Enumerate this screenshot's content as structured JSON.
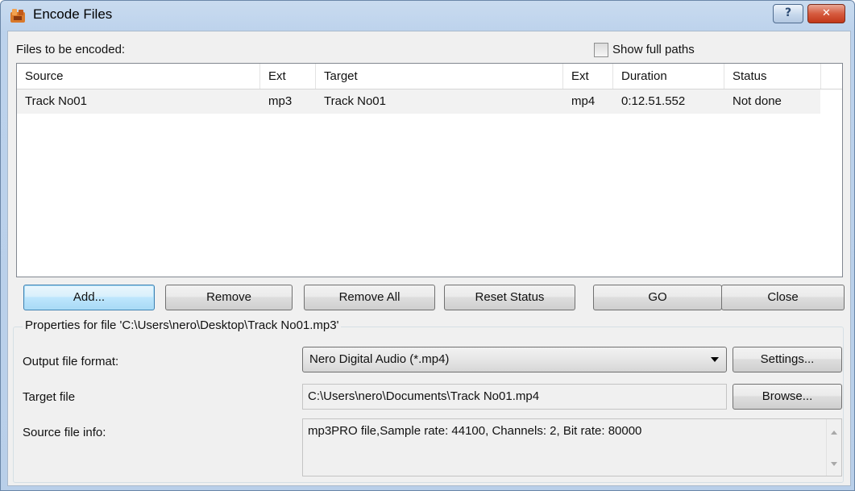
{
  "window": {
    "title": "Encode Files",
    "help_glyph": "?",
    "close_glyph": "✕"
  },
  "files": {
    "label": "Files to be encoded:",
    "show_full_paths_label": "Show full paths",
    "show_full_paths_checked": false,
    "columns": [
      "Source",
      "Ext",
      "Target",
      "Ext",
      "Duration",
      "Status"
    ],
    "rows": [
      [
        "Track No01",
        "mp3",
        "Track No01",
        "mp4",
        "0:12.51.552",
        "Not done"
      ]
    ]
  },
  "buttons": {
    "add": "Add...",
    "remove": "Remove",
    "remove_all": "Remove All",
    "reset_status": "Reset Status",
    "go": "GO",
    "close": "Close",
    "settings": "Settings...",
    "browse": "Browse..."
  },
  "properties": {
    "title": "Properties for file 'C:\\Users\\nero\\Desktop\\Track No01.mp3'",
    "output_format_label": "Output file format:",
    "output_format_value": "Nero Digital Audio (*.mp4)",
    "target_file_label": "Target file",
    "target_file_value": "C:\\Users\\nero\\Documents\\Track No01.mp4",
    "source_info_label": "Source file info:",
    "source_info_value": "mp3PRO file,Sample rate: 44100, Channels: 2, Bit rate: 80000"
  },
  "icons": {
    "app": "nero-app-icon",
    "help": "help-icon",
    "close": "close-icon",
    "dropdown": "chevron-down-icon"
  }
}
